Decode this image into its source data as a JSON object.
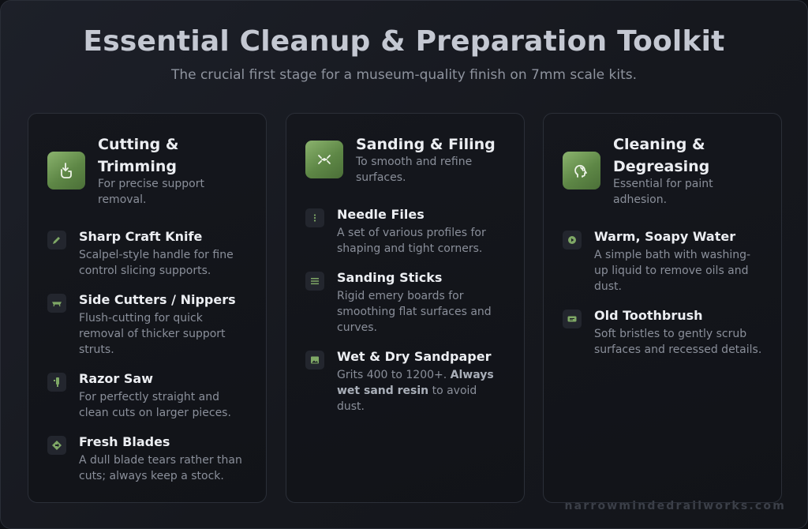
{
  "header": {
    "title": "Essential Cleanup & Preparation Toolkit",
    "subtitle": "The crucial first stage for a museum-quality finish on 7mm scale kits."
  },
  "cards": [
    {
      "icon": "hand-pointer-icon",
      "heading": "Cutting & Trimming",
      "subheading": "For precise support removal.",
      "items": [
        {
          "icon": "pencil-icon",
          "title": "Sharp Craft Knife",
          "desc": "Scalpel-style handle for fine control slicing supports."
        },
        {
          "icon": "cutters-icon",
          "title": "Side Cutters / Nippers",
          "desc": "Flush-cutting for quick removal of thicker support struts."
        },
        {
          "icon": "saw-icon",
          "title": "Razor Saw",
          "desc": "For perfectly straight and clean cuts on larger pieces."
        },
        {
          "icon": "arrow-diamond-icon",
          "title": "Fresh Blades",
          "desc": "A dull blade tears rather than cuts; always keep a stock."
        }
      ]
    },
    {
      "icon": "scatter-arrows-icon",
      "heading": "Sanding & Filing",
      "subheading": "To smooth and refine surfaces.",
      "items": [
        {
          "icon": "dots-vertical-icon",
          "title": "Needle Files",
          "desc": "A set of various profiles for shaping and tight corners."
        },
        {
          "icon": "bars-icon",
          "title": "Sanding Sticks",
          "desc": "Rigid emery boards for smoothing flat surfaces and curves."
        },
        {
          "icon": "image-icon",
          "title": "Wet & Dry Sandpaper",
          "desc_pre": "Grits 400 to 1200+. ",
          "desc_bold": "Always wet sand resin",
          "desc_post": " to avoid dust."
        }
      ]
    },
    {
      "icon": "head-sparkle-icon",
      "heading": "Cleaning & Degreasing",
      "subheading": "Essential for paint adhesion.",
      "items": [
        {
          "icon": "play-circle-icon",
          "title": "Warm, Soapy Water",
          "desc": "A simple bath with washing-up liquid to remove oils and dust."
        },
        {
          "icon": "brush-icon",
          "title": "Old Toothbrush",
          "desc": "Soft bristles to gently scrub surfaces and recessed details."
        }
      ]
    }
  ],
  "footer": {
    "text": "narrowmindedrailworks.com"
  },
  "colors": {
    "accent": "#6f9a55",
    "background": "#181a20",
    "heading": "#eceef2",
    "muted": "#8a8f9a"
  }
}
